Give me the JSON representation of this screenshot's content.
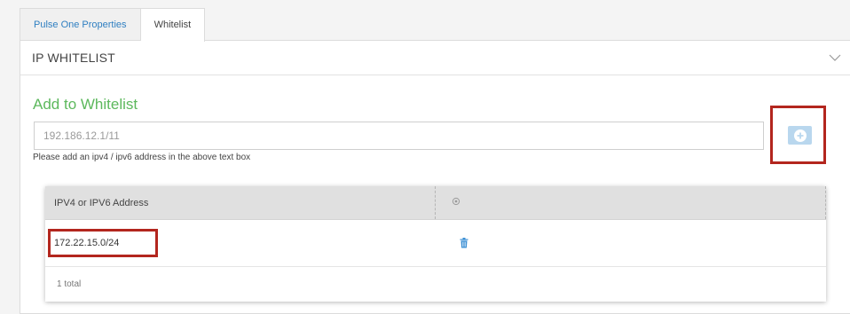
{
  "tabs": [
    {
      "label": "Pulse One Properties"
    },
    {
      "label": "Whitelist"
    }
  ],
  "panel": {
    "title": "IP WHITELIST"
  },
  "form": {
    "section_title": "Add to Whitelist",
    "input_placeholder": "192.186.12.1/11",
    "help_text": "Please add an ipv4 / ipv6 address in the above text box"
  },
  "table": {
    "column_address": "IPV4 or IPV6 Address",
    "rows": [
      {
        "address": "172.22.15.0/24"
      }
    ],
    "footer": "1 total"
  },
  "colors": {
    "accent_green": "#5cb85c",
    "link_blue": "#2f7fc1",
    "highlight_red": "#b3261e"
  }
}
